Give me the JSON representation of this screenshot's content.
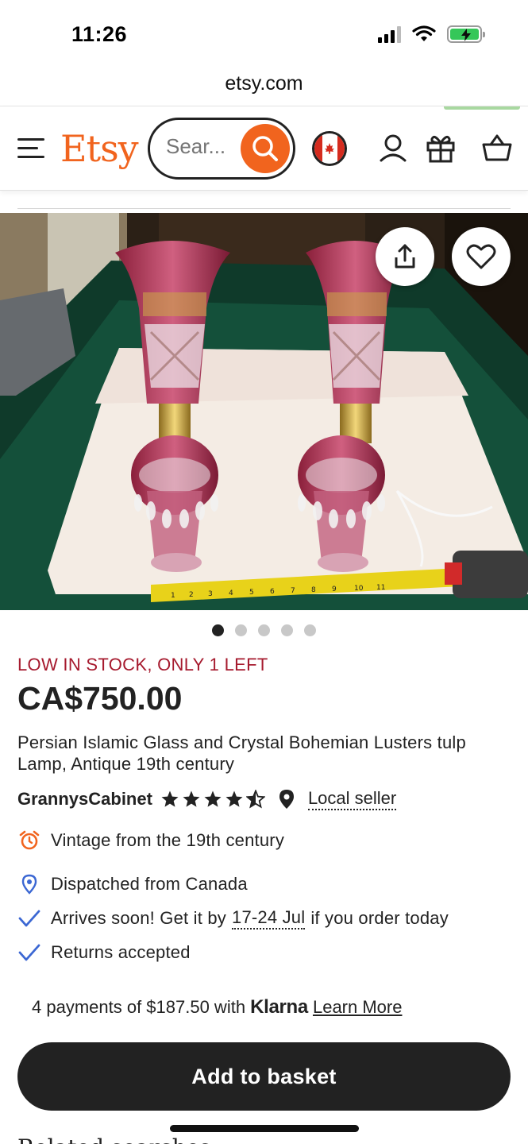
{
  "status_bar": {
    "time": "11:26"
  },
  "browser": {
    "url": "etsy.com"
  },
  "header": {
    "logo": "Etsy",
    "search_placeholder": "Sear...",
    "accent_color": "#f1641e"
  },
  "product": {
    "stock_note": "LOW IN STOCK, ONLY 1 LEFT",
    "price": "CA$750.00",
    "title": "Persian Islamic Glass and Crystal Bohemian Lusters tulp Lamp, Antique 19th century",
    "seller": "GrannysCabinet",
    "rating": 4.5,
    "local_seller_label": "Local seller",
    "image_count": 5,
    "active_image": 1
  },
  "features": {
    "vintage": "Vintage from the 19th century",
    "dispatch": "Dispatched from Canada",
    "arrives_prefix": "Arrives soon! Get it by",
    "arrives_dates": "17-24 Jul",
    "arrives_suffix": "if you order today",
    "returns": "Returns accepted"
  },
  "payments": {
    "text": "4 payments of $187.50 with",
    "brand": "Klarna",
    "link": "Learn More"
  },
  "cta": {
    "add_to_basket": "Add to basket"
  },
  "related": {
    "peek": "Related searches"
  }
}
